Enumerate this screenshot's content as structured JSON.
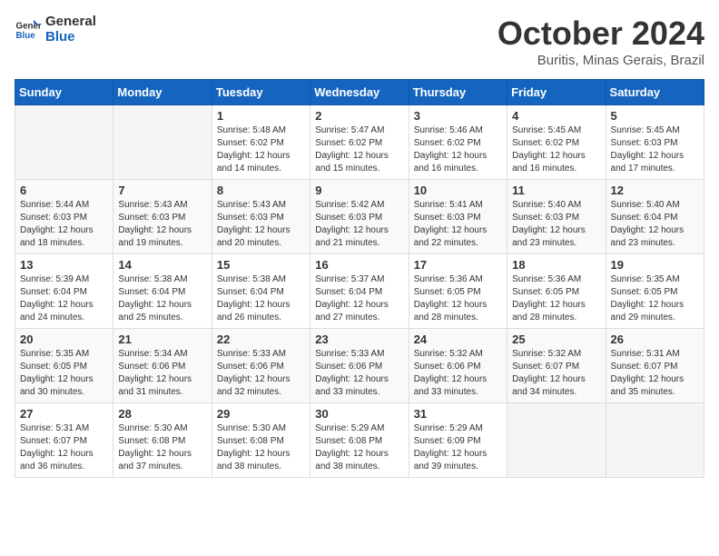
{
  "header": {
    "logo_line1": "General",
    "logo_line2": "Blue",
    "month": "October 2024",
    "location": "Buritis, Minas Gerais, Brazil"
  },
  "days_of_week": [
    "Sunday",
    "Monday",
    "Tuesday",
    "Wednesday",
    "Thursday",
    "Friday",
    "Saturday"
  ],
  "weeks": [
    [
      {
        "day": "",
        "sunrise": "",
        "sunset": "",
        "daylight": ""
      },
      {
        "day": "",
        "sunrise": "",
        "sunset": "",
        "daylight": ""
      },
      {
        "day": "1",
        "sunrise": "Sunrise: 5:48 AM",
        "sunset": "Sunset: 6:02 PM",
        "daylight": "Daylight: 12 hours and 14 minutes."
      },
      {
        "day": "2",
        "sunrise": "Sunrise: 5:47 AM",
        "sunset": "Sunset: 6:02 PM",
        "daylight": "Daylight: 12 hours and 15 minutes."
      },
      {
        "day": "3",
        "sunrise": "Sunrise: 5:46 AM",
        "sunset": "Sunset: 6:02 PM",
        "daylight": "Daylight: 12 hours and 16 minutes."
      },
      {
        "day": "4",
        "sunrise": "Sunrise: 5:45 AM",
        "sunset": "Sunset: 6:02 PM",
        "daylight": "Daylight: 12 hours and 16 minutes."
      },
      {
        "day": "5",
        "sunrise": "Sunrise: 5:45 AM",
        "sunset": "Sunset: 6:03 PM",
        "daylight": "Daylight: 12 hours and 17 minutes."
      }
    ],
    [
      {
        "day": "6",
        "sunrise": "Sunrise: 5:44 AM",
        "sunset": "Sunset: 6:03 PM",
        "daylight": "Daylight: 12 hours and 18 minutes."
      },
      {
        "day": "7",
        "sunrise": "Sunrise: 5:43 AM",
        "sunset": "Sunset: 6:03 PM",
        "daylight": "Daylight: 12 hours and 19 minutes."
      },
      {
        "day": "8",
        "sunrise": "Sunrise: 5:43 AM",
        "sunset": "Sunset: 6:03 PM",
        "daylight": "Daylight: 12 hours and 20 minutes."
      },
      {
        "day": "9",
        "sunrise": "Sunrise: 5:42 AM",
        "sunset": "Sunset: 6:03 PM",
        "daylight": "Daylight: 12 hours and 21 minutes."
      },
      {
        "day": "10",
        "sunrise": "Sunrise: 5:41 AM",
        "sunset": "Sunset: 6:03 PM",
        "daylight": "Daylight: 12 hours and 22 minutes."
      },
      {
        "day": "11",
        "sunrise": "Sunrise: 5:40 AM",
        "sunset": "Sunset: 6:03 PM",
        "daylight": "Daylight: 12 hours and 23 minutes."
      },
      {
        "day": "12",
        "sunrise": "Sunrise: 5:40 AM",
        "sunset": "Sunset: 6:04 PM",
        "daylight": "Daylight: 12 hours and 23 minutes."
      }
    ],
    [
      {
        "day": "13",
        "sunrise": "Sunrise: 5:39 AM",
        "sunset": "Sunset: 6:04 PM",
        "daylight": "Daylight: 12 hours and 24 minutes."
      },
      {
        "day": "14",
        "sunrise": "Sunrise: 5:38 AM",
        "sunset": "Sunset: 6:04 PM",
        "daylight": "Daylight: 12 hours and 25 minutes."
      },
      {
        "day": "15",
        "sunrise": "Sunrise: 5:38 AM",
        "sunset": "Sunset: 6:04 PM",
        "daylight": "Daylight: 12 hours and 26 minutes."
      },
      {
        "day": "16",
        "sunrise": "Sunrise: 5:37 AM",
        "sunset": "Sunset: 6:04 PM",
        "daylight": "Daylight: 12 hours and 27 minutes."
      },
      {
        "day": "17",
        "sunrise": "Sunrise: 5:36 AM",
        "sunset": "Sunset: 6:05 PM",
        "daylight": "Daylight: 12 hours and 28 minutes."
      },
      {
        "day": "18",
        "sunrise": "Sunrise: 5:36 AM",
        "sunset": "Sunset: 6:05 PM",
        "daylight": "Daylight: 12 hours and 28 minutes."
      },
      {
        "day": "19",
        "sunrise": "Sunrise: 5:35 AM",
        "sunset": "Sunset: 6:05 PM",
        "daylight": "Daylight: 12 hours and 29 minutes."
      }
    ],
    [
      {
        "day": "20",
        "sunrise": "Sunrise: 5:35 AM",
        "sunset": "Sunset: 6:05 PM",
        "daylight": "Daylight: 12 hours and 30 minutes."
      },
      {
        "day": "21",
        "sunrise": "Sunrise: 5:34 AM",
        "sunset": "Sunset: 6:06 PM",
        "daylight": "Daylight: 12 hours and 31 minutes."
      },
      {
        "day": "22",
        "sunrise": "Sunrise: 5:33 AM",
        "sunset": "Sunset: 6:06 PM",
        "daylight": "Daylight: 12 hours and 32 minutes."
      },
      {
        "day": "23",
        "sunrise": "Sunrise: 5:33 AM",
        "sunset": "Sunset: 6:06 PM",
        "daylight": "Daylight: 12 hours and 33 minutes."
      },
      {
        "day": "24",
        "sunrise": "Sunrise: 5:32 AM",
        "sunset": "Sunset: 6:06 PM",
        "daylight": "Daylight: 12 hours and 33 minutes."
      },
      {
        "day": "25",
        "sunrise": "Sunrise: 5:32 AM",
        "sunset": "Sunset: 6:07 PM",
        "daylight": "Daylight: 12 hours and 34 minutes."
      },
      {
        "day": "26",
        "sunrise": "Sunrise: 5:31 AM",
        "sunset": "Sunset: 6:07 PM",
        "daylight": "Daylight: 12 hours and 35 minutes."
      }
    ],
    [
      {
        "day": "27",
        "sunrise": "Sunrise: 5:31 AM",
        "sunset": "Sunset: 6:07 PM",
        "daylight": "Daylight: 12 hours and 36 minutes."
      },
      {
        "day": "28",
        "sunrise": "Sunrise: 5:30 AM",
        "sunset": "Sunset: 6:08 PM",
        "daylight": "Daylight: 12 hours and 37 minutes."
      },
      {
        "day": "29",
        "sunrise": "Sunrise: 5:30 AM",
        "sunset": "Sunset: 6:08 PM",
        "daylight": "Daylight: 12 hours and 38 minutes."
      },
      {
        "day": "30",
        "sunrise": "Sunrise: 5:29 AM",
        "sunset": "Sunset: 6:08 PM",
        "daylight": "Daylight: 12 hours and 38 minutes."
      },
      {
        "day": "31",
        "sunrise": "Sunrise: 5:29 AM",
        "sunset": "Sunset: 6:09 PM",
        "daylight": "Daylight: 12 hours and 39 minutes."
      },
      {
        "day": "",
        "sunrise": "",
        "sunset": "",
        "daylight": ""
      },
      {
        "day": "",
        "sunrise": "",
        "sunset": "",
        "daylight": ""
      }
    ]
  ]
}
